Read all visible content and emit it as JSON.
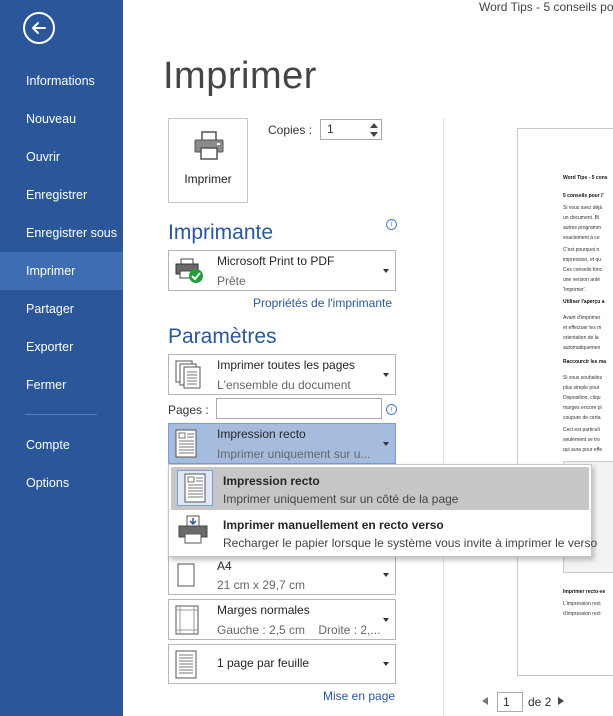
{
  "window": {
    "doc_title": "Word Tips - 5 conseils po"
  },
  "sidebar": {
    "items": [
      {
        "label": "Informations"
      },
      {
        "label": "Nouveau"
      },
      {
        "label": "Ouvrir"
      },
      {
        "label": "Enregistrer"
      },
      {
        "label": "Enregistrer sous"
      },
      {
        "label": "Imprimer",
        "active": true
      },
      {
        "label": "Partager"
      },
      {
        "label": "Exporter"
      },
      {
        "label": "Fermer"
      },
      {
        "label": "Compte"
      },
      {
        "label": "Options"
      }
    ]
  },
  "main": {
    "title": "Imprimer",
    "print_button": "Imprimer",
    "copies_label": "Copies :",
    "copies_value": "1"
  },
  "printer": {
    "section_title": "Imprimante",
    "name": "Microsoft Print to PDF",
    "status": "Prête",
    "properties_link": "Propriétés de l'imprimante"
  },
  "settings": {
    "section_title": "Paramètres",
    "pages_scope": {
      "title": "Imprimer toutes les pages",
      "desc": "L'ensemble du document"
    },
    "pages_label": "Pages :",
    "pages_value": "",
    "sides": {
      "title": "Impression recto",
      "desc": "Imprimer uniquement sur un côté de la page"
    },
    "sides_desc_truncated": "Imprimer uniquement sur u...",
    "sides_options": [
      {
        "title": "Impression recto",
        "desc": "Imprimer uniquement sur un côté de la page"
      },
      {
        "title": "Imprimer manuellement en recto verso",
        "desc": "Recharger le papier lorsque le système vous invite à imprimer le verso"
      }
    ],
    "paper": {
      "title": "A4",
      "desc": "21 cm x 29,7 cm"
    },
    "margins": {
      "title": "Marges normales",
      "desc": "Gauche : 2,5 cm    Droite : 2,..."
    },
    "per_sheet": {
      "title": "1 page par feuille"
    },
    "page_setup_link": "Mise en page"
  },
  "preview": {
    "lines": [
      {
        "text": "Word Tips - 5 cons",
        "bold": true
      },
      {
        "text": "5 conseils pour l'",
        "bold": true
      },
      {
        "text": "Si vous avez déjà"
      },
      {
        "text": "un document. Bi"
      },
      {
        "text": "autres programm"
      },
      {
        "text": "exactement à ce"
      },
      {
        "text": "C'est pourquoi n"
      },
      {
        "text": "impression, et qu"
      },
      {
        "text": "Ces conseils fonc"
      },
      {
        "text": "une version anté"
      },
      {
        "text": "'Imprimer'."
      },
      {
        "text": "Utiliser l'aperçu a",
        "bold": true
      },
      {
        "text": "Avant d'imprimer"
      },
      {
        "text": "et effectuer les m"
      },
      {
        "text": "orientation de la"
      },
      {
        "text": "automatiquemen"
      },
      {
        "text": "Raccourcir les ma",
        "bold": true
      },
      {
        "text": "Si vous souhaitez"
      },
      {
        "text": "plus simple pour"
      },
      {
        "text": "Disposition, cliqu"
      },
      {
        "text": "marges encore pl"
      },
      {
        "text": "coupure de certa"
      },
      {
        "text": "Ceci est particuli"
      },
      {
        "text": "seulement se tro"
      },
      {
        "text": "qui aura pour effe"
      },
      {
        "text": "Imprimer recto-ve",
        "bold": true
      },
      {
        "text": "L'impression rect"
      },
      {
        "text": "d'impression rect"
      }
    ],
    "current_page": "1",
    "of_pages": "de 2"
  }
}
